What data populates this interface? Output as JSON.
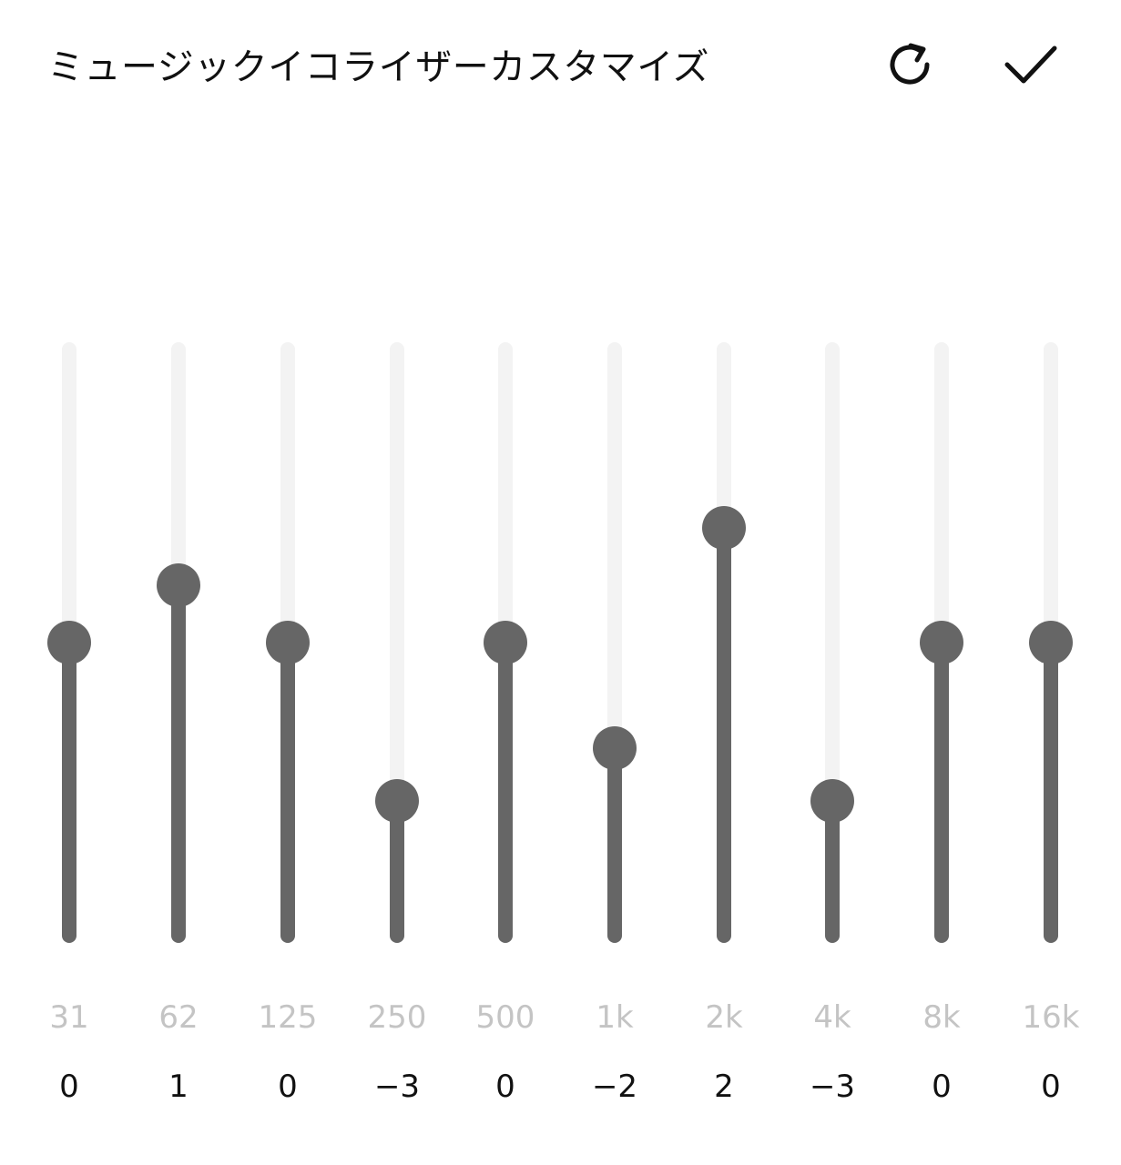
{
  "header": {
    "title": "ミュージックイコライザーカスタマイズ",
    "reset_icon": "refresh-icon",
    "confirm_icon": "check-icon"
  },
  "equalizer": {
    "range": [
      -5,
      5
    ],
    "colors": {
      "track": "#f3f3f3",
      "active": "#666666",
      "frequency_label": "#c4c4c4",
      "gain_label": "#111111"
    },
    "bands": [
      {
        "frequency": "31",
        "gain": 0,
        "gain_label": "0"
      },
      {
        "frequency": "62",
        "gain": 1,
        "gain_label": "1"
      },
      {
        "frequency": "125",
        "gain": 0,
        "gain_label": "0"
      },
      {
        "frequency": "250",
        "gain": -3,
        "gain_label": "−3"
      },
      {
        "frequency": "500",
        "gain": 0,
        "gain_label": "0"
      },
      {
        "frequency": "1k",
        "gain": -2,
        "gain_label": "−2"
      },
      {
        "frequency": "2k",
        "gain": 2,
        "gain_label": "2"
      },
      {
        "frequency": "4k",
        "gain": -3,
        "gain_label": "−3"
      },
      {
        "frequency": "8k",
        "gain": 0,
        "gain_label": "0"
      },
      {
        "frequency": "16k",
        "gain": 0,
        "gain_label": "0"
      }
    ]
  }
}
